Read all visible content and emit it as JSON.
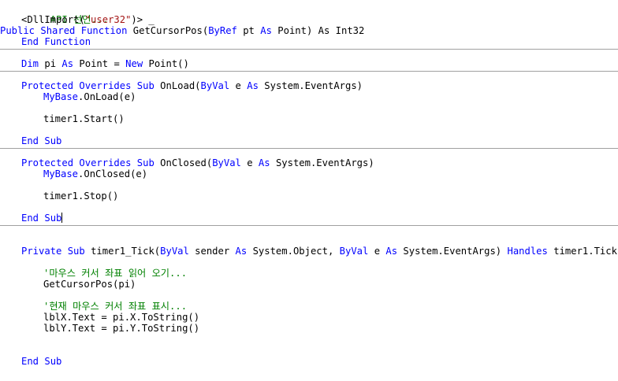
{
  "code": {
    "comment_api_declaration": "'API 선언...",
    "dllimport_open": "<DllImport(",
    "dllimport_lib": "\"user32\"",
    "dllimport_close": ")> _",
    "kw_public": "Public",
    "kw_shared": "Shared",
    "kw_function": "Function",
    "fn_getcursorpos_decl": "GetCursorPos(",
    "kw_byref": "ByRef",
    "param_pt": "pt",
    "kw_as": "As",
    "type_point_int32": "Point) As Int32",
    "kw_end": "End",
    "kw_dim": "Dim",
    "var_pi": "pi",
    "type_point_eq": "Point =",
    "kw_new": "New",
    "new_point_call": "Point()",
    "kw_protected": "Protected",
    "kw_overrides": "Overrides",
    "kw_sub": "Sub",
    "onload_name": "OnLoad(",
    "kw_byval": "ByVal",
    "param_e": "e",
    "type_eventargs": "System.EventArgs)",
    "kw_mybase": "MyBase",
    "mybase_onload": ".OnLoad(e)",
    "timer_start": "timer1.Start()",
    "onclosed_name": "OnClosed(",
    "mybase_onclosed": ".OnClosed(e)",
    "timer_stop": "timer1.Stop()",
    "kw_private": "Private",
    "tick_name": "timer1_Tick(",
    "param_sender": "sender",
    "type_object": "System.Object,",
    "kw_handles": "Handles",
    "handles_target": "timer1.Tick",
    "comment_read_coords": "'마우스 커서 좌표 읽어 오기...",
    "call_getcursorpos": "GetCursorPos(pi)",
    "comment_show_coords": "'현재 마우스 커서 좌표 표시...",
    "lblx_assign": "lblX.Text = pi.X.ToString()",
    "lbly_assign": "lblY.Text = pi.Y.ToString()"
  },
  "colors": {
    "keyword": "#0000ff",
    "comment": "#008000",
    "string": "#a31515",
    "text": "#000000",
    "separator": "#a0a0a0"
  }
}
